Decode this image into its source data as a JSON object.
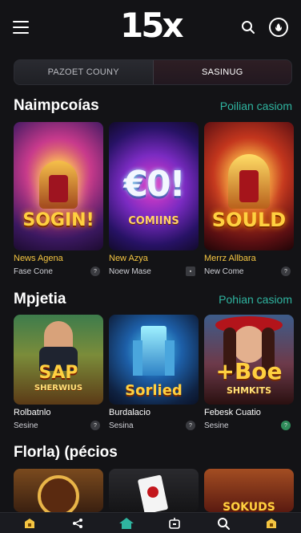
{
  "app": {
    "logo": "15x"
  },
  "tabs": {
    "left": "PAZOET COUNY",
    "right": "SASINUG"
  },
  "sections": [
    {
      "title": "Naimpcoías",
      "see_all": "Poilian casiom",
      "games": [
        {
          "art_text": "SOGIN!",
          "name": "News Agena",
          "sub": "Fase Cone"
        },
        {
          "art_text": "€0!",
          "art_sub": "COMIINS",
          "name": "New Azya",
          "sub": "Noew Mase"
        },
        {
          "art_text": "SOULD",
          "name": "Merrz Allbara",
          "sub": "New Come"
        }
      ]
    },
    {
      "title": "Mpjetia",
      "see_all": "Pohian casiom",
      "games": [
        {
          "art_text": "SAP",
          "art_sub": "SHERWIUS",
          "name": "Rolbatnlo",
          "sub": "Sesine"
        },
        {
          "art_text": "Sorlied",
          "name": "Burdalacio",
          "sub": "Sesina"
        },
        {
          "art_text": "+Boe",
          "art_sub": "SHMKITS",
          "name": "Febesk Cuatio",
          "sub": "Sesine"
        }
      ]
    },
    {
      "title": "Florla) (pécios",
      "games": [
        {
          "art_text": ""
        },
        {
          "art_text": ""
        },
        {
          "art_text": "SOKUDS"
        }
      ]
    }
  ],
  "colors": {
    "accent": "#2fb5a0",
    "gold": "#f4c542",
    "bg": "#131316"
  },
  "icons": [
    "menu-icon",
    "search-icon",
    "profile-icon",
    "bonus-icon",
    "share-icon",
    "home-icon",
    "live-tv-icon",
    "search-nav-icon",
    "gift-icon"
  ]
}
